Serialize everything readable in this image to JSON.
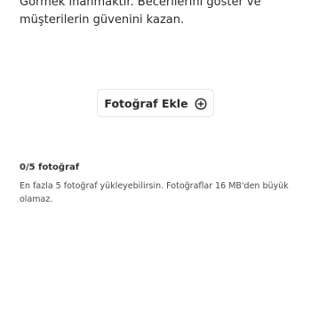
{
  "intro": {
    "text": "Görmek inanmaktır. Becerilerini göster ve müşterilerin güvenini kazan."
  },
  "add_photo": {
    "label": "Fotoğraf Ekle",
    "icon": "plus-circle-icon"
  },
  "photos": {
    "count_text": "0/5 fotoğraf",
    "hint": "En fazla 5 fotoğraf yükleyebilirsin. Fotoğraflar 16 MB'den büyük olamaz."
  }
}
